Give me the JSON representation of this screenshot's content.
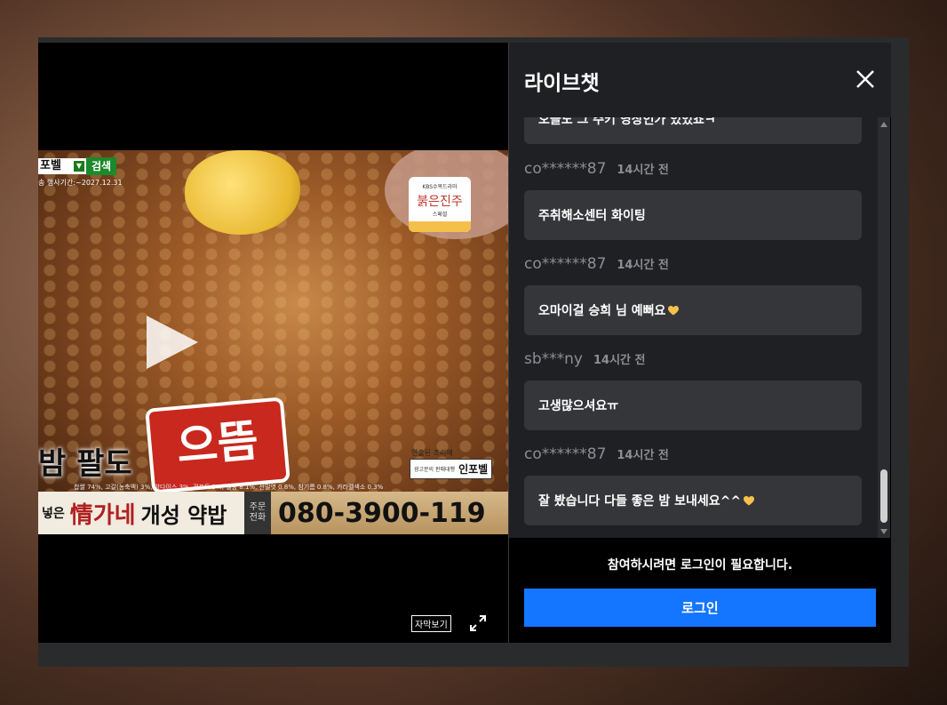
{
  "video": {
    "search_select": "포벨",
    "search_button": "검색",
    "promo_date": "송 행사기간:~2027.12.31",
    "badge": {
      "line1": "KBS수목드라마",
      "title": "붉은진주",
      "line3": "스페셜"
    },
    "logo_text": "으뜸",
    "banner_text": "팔도",
    "brand_caption": "연출된 조리예",
    "brand_ad": "광고문의 판매대행",
    "brand_name": "인포벨",
    "ingredients": "찹쌀 74%, 고갈(농축액) 3%, 밤다이스 3%, 건포도 3%, 설탕 8.1%, 전밀엿 0.8%, 참기름 0.8%, 카라멜색소 0.3%",
    "product_small": "넣은",
    "product_calli": "情가네",
    "product_name": "개성 약밥",
    "order_label": "주문\n전화",
    "phone": "080-3900-119",
    "subtitle_button": "자막보기"
  },
  "chat": {
    "title": "라이브챗",
    "messages": [
      {
        "user": "",
        "time": "",
        "text": "오늘도 그 주키 영상인가 있었죠ㅋ",
        "heart": false
      },
      {
        "user": "co******87",
        "time": "14시간 전",
        "text": "주취해소센터 화이팅",
        "heart": false
      },
      {
        "user": "co******87",
        "time": "14시간 전",
        "text": "오마이걸 승희 님 예뻐요",
        "heart": true
      },
      {
        "user": "sb***ny",
        "time": "14시간 전",
        "text": "고생많으셔요ㅠ",
        "heart": false
      },
      {
        "user": "co******87",
        "time": "14시간 전",
        "text": "잘 봤습니다 다들 좋은 밤 보내세요^^",
        "heart": true
      }
    ],
    "login_note": "참여하시려면 로그인이 필요합니다.",
    "login_button": "로그인"
  },
  "colors": {
    "accent": "#1475ff",
    "panel": "#1f2023",
    "bubble": "#35363a"
  }
}
